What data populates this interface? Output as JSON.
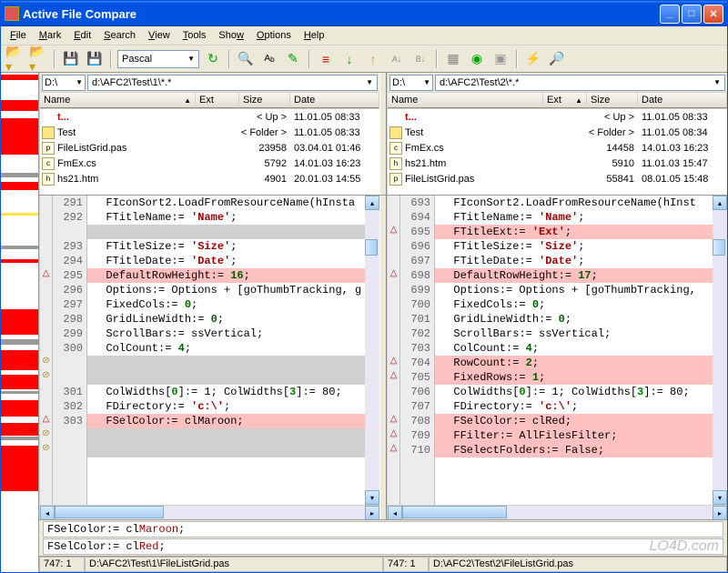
{
  "title": "Active File Compare",
  "menu": [
    "File",
    "Mark",
    "Edit",
    "Search",
    "View",
    "Tools",
    "Show",
    "Options",
    "Help"
  ],
  "toolbar": {
    "lang": "Pascal"
  },
  "left": {
    "drive": "D:\\",
    "path": "d:\\AFC2\\Test\\1\\*.*",
    "headers": [
      "Name",
      "Ext",
      "Size",
      "Date"
    ],
    "files": [
      {
        "name": "t...",
        "size": "< Up >",
        "date": "11.01.05 08:33",
        "up": true
      },
      {
        "name": "Test",
        "size": "< Folder >",
        "date": "11.01.05 08:33",
        "fold": true
      },
      {
        "name": "FileListGrid.pas",
        "size": "23958",
        "date": "03.04.01 01:46",
        "ico": "p"
      },
      {
        "name": "FmEx.cs",
        "size": "5792",
        "date": "14.01.03 16:23",
        "ico": "c"
      },
      {
        "name": "hs21.htm",
        "size": "4901",
        "date": "20.01.03 14:55",
        "ico": "h"
      }
    ],
    "code": [
      {
        "n": 291,
        "t": "  FIconSort2.LoadFromResourceName(hInsta"
      },
      {
        "n": 292,
        "t": "  FTitleName:= 'Name';",
        "str": "'Name'"
      },
      {
        "n": 0,
        "gap": true,
        "diff": true
      },
      {
        "n": 293,
        "t": "  FTitleSize:= 'Size';",
        "str": "'Size'"
      },
      {
        "n": 294,
        "t": "  FTitleDate:= 'Date';",
        "str": "'Date'"
      },
      {
        "n": 295,
        "t": "  DefaultRowHeight:= 16;",
        "diff": true,
        "mark": "△",
        "num": "16"
      },
      {
        "n": 296,
        "t": "  Options:= Options + [goThumbTracking, g"
      },
      {
        "n": 297,
        "t": "  FixedCols:= 0;",
        "num": "0"
      },
      {
        "n": 298,
        "t": "  GridLineWidth:= 0;",
        "num": "0"
      },
      {
        "n": 299,
        "t": "  ScrollBars:= ssVertical;"
      },
      {
        "n": 300,
        "t": "  ColCount:= 4;",
        "num": "4"
      },
      {
        "n": 0,
        "gap": true,
        "mark": "⊘"
      },
      {
        "n": 0,
        "gap": true,
        "mark": "⊘"
      },
      {
        "n": 301,
        "t": "  ColWidths[0]:= 1; ColWidths[3]:= 80;"
      },
      {
        "n": 302,
        "t": "  FDirectory:= 'c:\\';",
        "str": "'c:\\'"
      },
      {
        "n": 303,
        "t": "  FSelColor:= clMaroon;",
        "diff": true,
        "mark": "△"
      },
      {
        "n": 0,
        "gap": true,
        "mark": "⊘"
      },
      {
        "n": 0,
        "gap": true,
        "mark": "⊘"
      }
    ]
  },
  "right": {
    "drive": "D:\\",
    "path": "d:\\AFC2\\Test\\2\\*.*",
    "headers": [
      "Name",
      "Ext",
      "Size",
      "Date"
    ],
    "files": [
      {
        "name": "t...",
        "size": "< Up >",
        "date": "11.01.05 08:33",
        "up": true
      },
      {
        "name": "Test",
        "size": "< Folder >",
        "date": "11.01.05 08:34",
        "fold": true
      },
      {
        "name": "FmEx.cs",
        "size": "14458",
        "date": "14.01.03 16:23",
        "ico": "c"
      },
      {
        "name": "hs21.htm",
        "size": "5910",
        "date": "11.01.03 15:47",
        "ico": "h"
      },
      {
        "name": "FileListGrid.pas",
        "size": "55841",
        "date": "08.01.05 15:48",
        "ico": "p"
      }
    ],
    "code": [
      {
        "n": 693,
        "t": "  FIconSort2.LoadFromResourceName(hInst"
      },
      {
        "n": 694,
        "t": "  FTitleName:= 'Name';",
        "str": "'Name'"
      },
      {
        "n": 695,
        "t": "  FTitleExt:= 'Ext';",
        "diff": true,
        "mark": "△",
        "str": "'Ext'"
      },
      {
        "n": 696,
        "t": "  FTitleSize:= 'Size';",
        "str": "'Size'"
      },
      {
        "n": 697,
        "t": "  FTitleDate:= 'Date';",
        "str": "'Date'"
      },
      {
        "n": 698,
        "t": "  DefaultRowHeight:= 17;",
        "diff": true,
        "mark": "△",
        "num": "17"
      },
      {
        "n": 699,
        "t": "  Options:= Options + [goThumbTracking,"
      },
      {
        "n": 700,
        "t": "  FixedCols:= 0;",
        "num": "0"
      },
      {
        "n": 701,
        "t": "  GridLineWidth:= 0;",
        "num": "0"
      },
      {
        "n": 702,
        "t": "  ScrollBars:= ssVertical;"
      },
      {
        "n": 703,
        "t": "  ColCount:= 4;",
        "num": "4"
      },
      {
        "n": 704,
        "t": "  RowCount:= 2;",
        "diff": true,
        "mark": "△",
        "num": "2"
      },
      {
        "n": 705,
        "t": "  FixedRows:= 1;",
        "diff": true,
        "mark": "△",
        "num": "1"
      },
      {
        "n": 706,
        "t": "  ColWidths[0]:= 1; ColWidths[3]:= 80;"
      },
      {
        "n": 707,
        "t": "  FDirectory:= 'c:\\';",
        "str": "'c:\\'"
      },
      {
        "n": 708,
        "t": "  FSelColor:= clRed;",
        "diff": true,
        "mark": "△"
      },
      {
        "n": 709,
        "t": "  FFilter:= AllFilesFilter;",
        "diff": true,
        "mark": "△"
      },
      {
        "n": 710,
        "t": "  FSelectFolders:= False;",
        "diff": true,
        "mark": "△"
      }
    ]
  },
  "bottomdiff": [
    {
      "pre": "FSelColor:= cl",
      "hl": "Maroon",
      "post": ";"
    },
    {
      "pre": "FSelColor:= cl",
      "hl": "Red",
      "post": ";"
    }
  ],
  "status": {
    "pos1": "747: 1",
    "path1": "D:\\AFC2\\Test\\1\\FileListGrid.pas",
    "pos2": "747: 1",
    "path2": "D:\\AFC2\\Test\\2\\FileListGrid.pas"
  },
  "watermark": "LO4D.com"
}
